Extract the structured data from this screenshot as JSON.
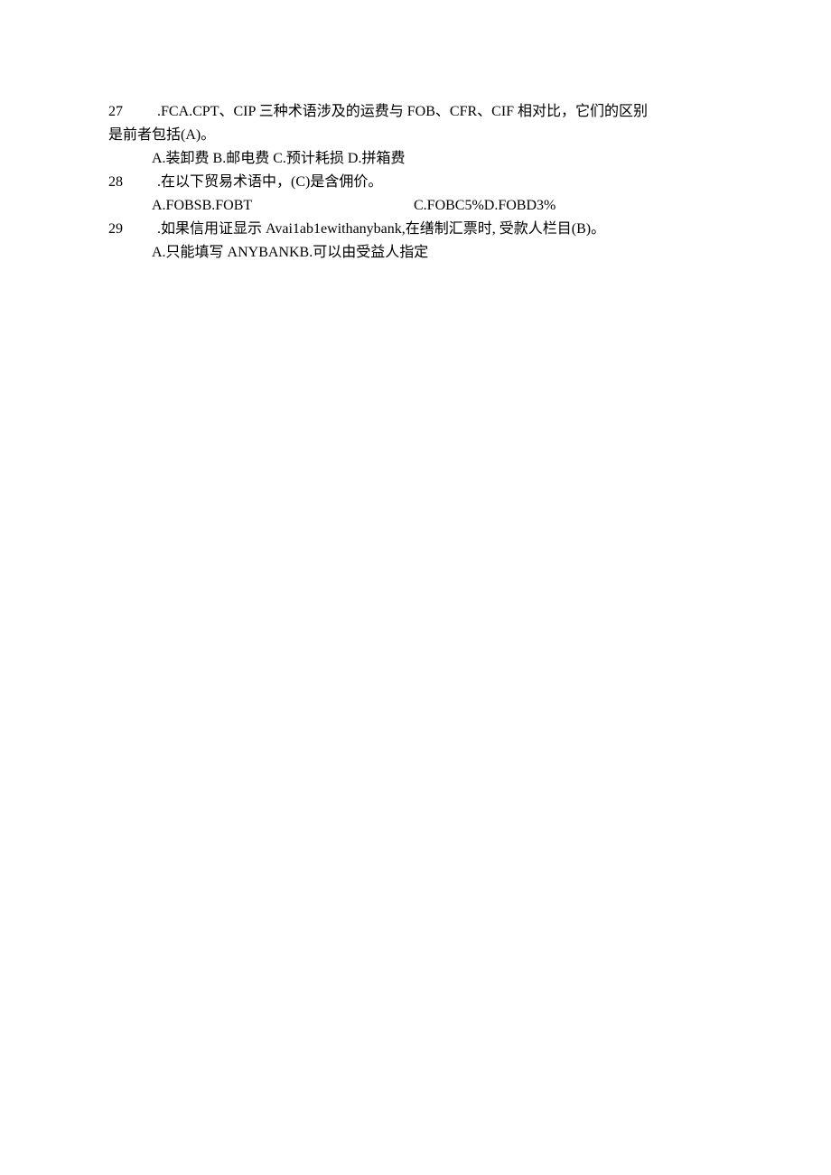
{
  "q27": {
    "num": "27",
    "line1_part1": "  .FCA.CPT、CIP 三种术语涉及的运费与 FOB、CFR、CIF 相对比，它们的区别",
    "line2": "是前者包括(A)。",
    "options": "A.装卸费 B.邮电费 C.预计耗损 D.拼箱费"
  },
  "q28": {
    "num": "28",
    "stem": "  .在以下贸易术语中，(C)是含佣价。",
    "options_left": "A.FOBSB.FOBT",
    "options_right": "C.FOBC5%D.FOBD3%"
  },
  "q29": {
    "num": "29",
    "stem": "  .如果信用证显示 Avai1ab1ewithanybank,在缮制汇票时, 受款人栏目(B)。",
    "options": "A.只能填写 ANYBANKB.可以由受益人指定"
  }
}
